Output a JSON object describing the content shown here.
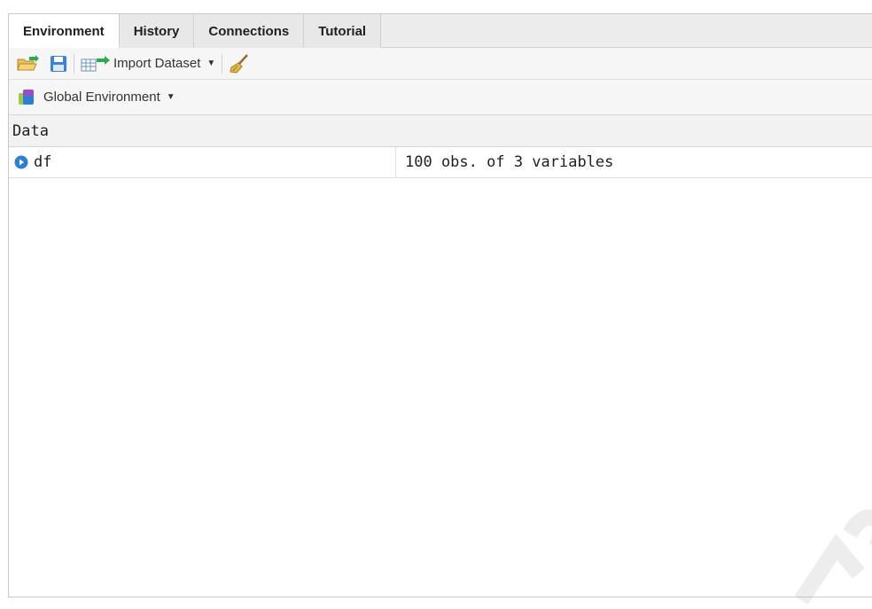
{
  "tabs": [
    "Environment",
    "History",
    "Connections",
    "Tutorial"
  ],
  "active_tab": "Environment",
  "toolbar": {
    "import_label": "Import Dataset",
    "open_icon": "open-folder-icon",
    "save_icon": "save-icon",
    "import_icon": "import-dataset-icon",
    "clear_icon": "broom-icon"
  },
  "environment": {
    "selected": "Global Environment",
    "icon": "environment-icon"
  },
  "section_header": "Data",
  "rows": [
    {
      "name": "df",
      "value": "100 obs. of 3 variables"
    }
  ],
  "colors": {
    "accent_blue": "#2c7fd1",
    "tab_bg": "#ececec",
    "toolbar_bg": "#f6f6f6"
  }
}
